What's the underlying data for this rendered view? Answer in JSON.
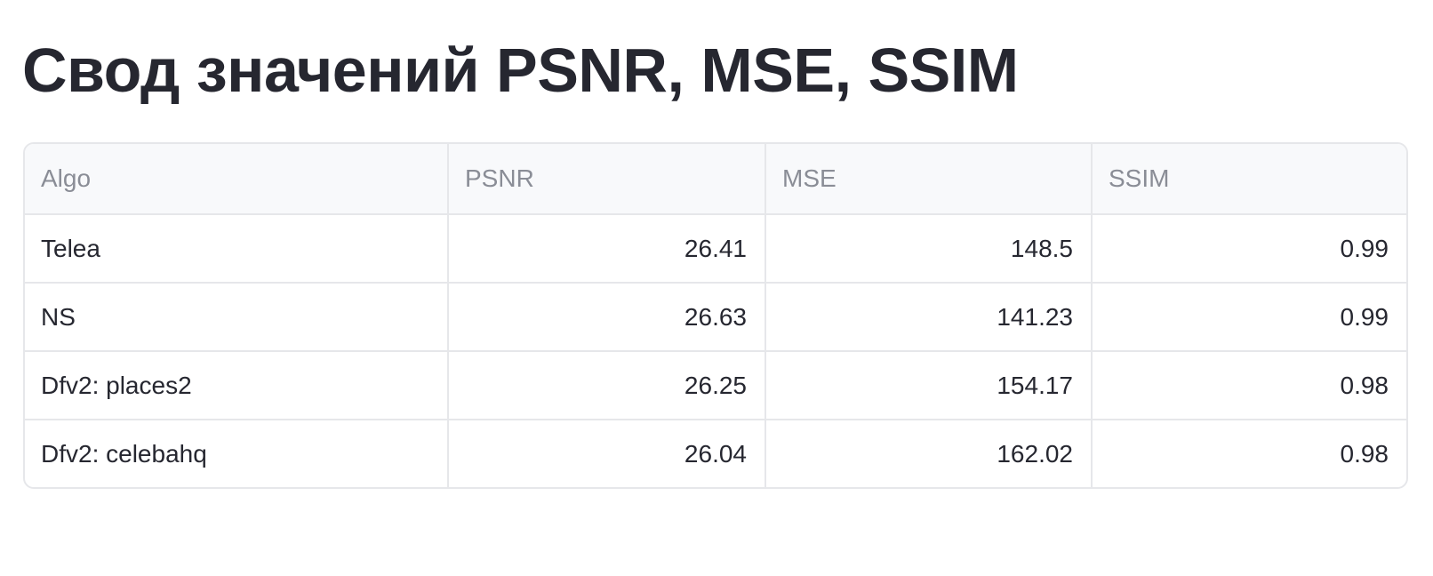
{
  "page": {
    "title": "Свод значений PSNR, MSE, SSIM"
  },
  "table": {
    "columns": [
      "Algo",
      "PSNR",
      "MSE",
      "SSIM"
    ],
    "rows": [
      {
        "algo": "Telea",
        "psnr": "26.41",
        "mse": "148.5",
        "ssim": "0.99"
      },
      {
        "algo": "NS",
        "psnr": "26.63",
        "mse": "141.23",
        "ssim": "0.99"
      },
      {
        "algo": "Dfv2: places2",
        "psnr": "26.25",
        "mse": "154.17",
        "ssim": "0.98"
      },
      {
        "algo": "Dfv2: celebahq",
        "psnr": "26.04",
        "mse": "162.02",
        "ssim": "0.98"
      }
    ]
  },
  "colors": {
    "text": "#262730",
    "header_text": "#8a8d96",
    "header_bg": "#f8f9fb",
    "border": "#e6e7ea"
  }
}
